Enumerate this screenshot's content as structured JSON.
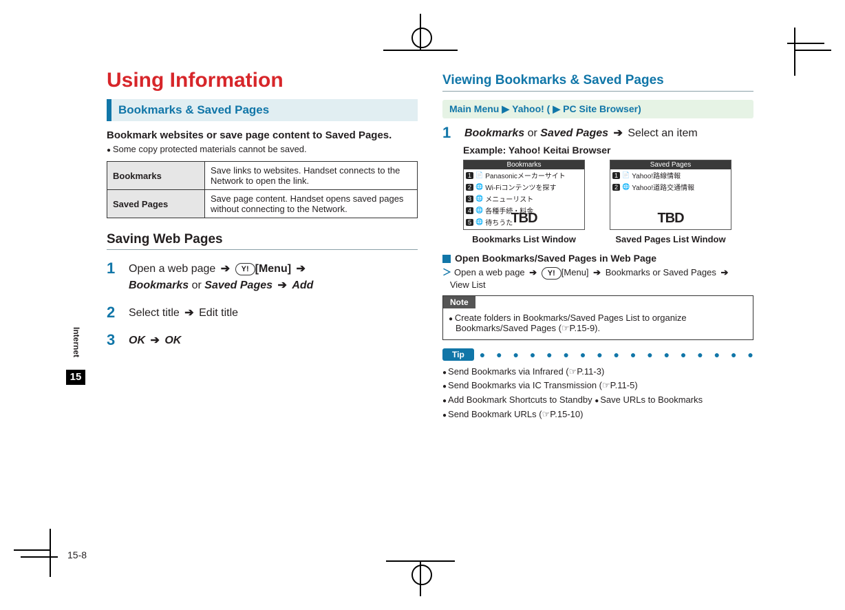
{
  "sideTab": {
    "label": "Internet",
    "chapter": "15"
  },
  "pageNumber": "15-8",
  "left": {
    "title": "Using Information",
    "sectionBar": "Bookmarks & Saved Pages",
    "intro": "Bookmark websites or save page content to Saved Pages.",
    "introBullet": "Some copy protected materials cannot be saved.",
    "table": {
      "r1h": "Bookmarks",
      "r1": "Save links to websites. Handset connects to the Network to open the link.",
      "r2h": "Saved Pages",
      "r2": "Save page content. Handset opens saved pages without connecting to the Network."
    },
    "savingHead": "Saving Web Pages",
    "step1_a": "Open a web page ",
    "step1_key": "Y!",
    "step1_menu": "[Menu]",
    "step1_b": "Bookmarks",
    "step1_or": " or ",
    "step1_c": "Saved Pages",
    "step1_d": "Add",
    "step2_a": "Select title ",
    "step2_b": " Edit title",
    "step3_a": "OK",
    "step3_b": "OK"
  },
  "right": {
    "title": "Viewing Bookmarks & Saved Pages",
    "menuPath_a": "Main Menu",
    "menuPath_b": "Yahoo! (",
    "menuPath_c": "PC Site Browser)",
    "step1_a": "Bookmarks",
    "step1_or": " or ",
    "step1_b": "Saved Pages",
    "step1_c": " Select an item",
    "example": "Example: Yahoo! Keitai Browser",
    "shot1": {
      "title": "Bookmarks",
      "rows": [
        "Panasonicメーカーサイト",
        "Wi-Fiコンテンツを探す",
        "メニューリスト",
        "各種手続・料金",
        "待ちうた"
      ],
      "tbd": "TBD",
      "caption": "Bookmarks List Window"
    },
    "shot2": {
      "title": "Saved Pages",
      "rows": [
        "Yahoo!路線情報",
        "Yahoo!道路交通情報"
      ],
      "tbd": "TBD",
      "caption": "Saved Pages List Window"
    },
    "openHead": "Open Bookmarks/Saved Pages in Web Page",
    "openLine_a": "Open a web page ",
    "openLine_key": "Y!",
    "openLine_menu": "[Menu]",
    "openLine_b": "Bookmarks",
    "openLine_or": " or ",
    "openLine_c": "Saved Pages",
    "openLine_d": "View List",
    "noteLabel": "Note",
    "noteBody": "Create folders in Bookmarks/Saved Pages List to organize Bookmarks/Saved Pages (☞P.15-9).",
    "tipLabel": "Tip",
    "tips": {
      "t1": "Send Bookmarks via Infrared (☞P.11-3)",
      "t2": "Send Bookmarks via IC Transmission (☞P.11-5)",
      "t3": "Add Bookmark Shortcuts to Standby ",
      "t4": "Save URLs to Bookmarks",
      "t5": "Send Bookmark URLs (☞P.15-10)"
    }
  }
}
